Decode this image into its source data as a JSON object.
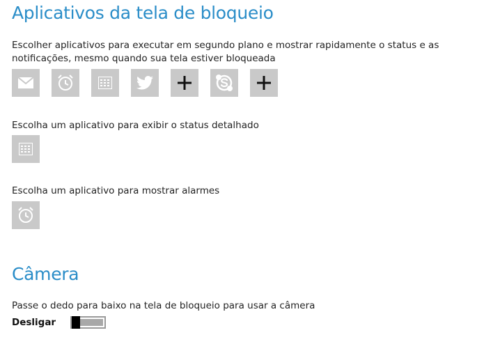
{
  "lock_screen": {
    "title": "Aplicativos da tela de bloqueio",
    "background_apps_desc": "Escolher aplicativos para executar em segundo plano e mostrar rapidamente o status e as notificações, mesmo quando sua tela estiver bloqueada",
    "background_apps": [
      {
        "icon": "mail-icon"
      },
      {
        "icon": "alarm-clock-icon"
      },
      {
        "icon": "calendar-icon"
      },
      {
        "icon": "twitter-icon"
      },
      {
        "icon": "plus-icon"
      },
      {
        "icon": "skype-icon"
      },
      {
        "icon": "plus-icon"
      }
    ],
    "detailed_status_desc": "Escolha um aplicativo para exibir o status detalhado",
    "detailed_status_app": {
      "icon": "calendar-icon"
    },
    "alarms_desc": "Escolha um aplicativo para mostrar alarmes",
    "alarms_app": {
      "icon": "alarm-clock-icon"
    }
  },
  "camera": {
    "title": "Câmera",
    "desc": "Passe o dedo para baixo na tela de bloqueio para usar a câmera",
    "toggle_label": "Desligar",
    "toggle_on": false
  },
  "colors": {
    "heading": "#2a8dc8",
    "tile_bg": "#c9c9c9"
  }
}
